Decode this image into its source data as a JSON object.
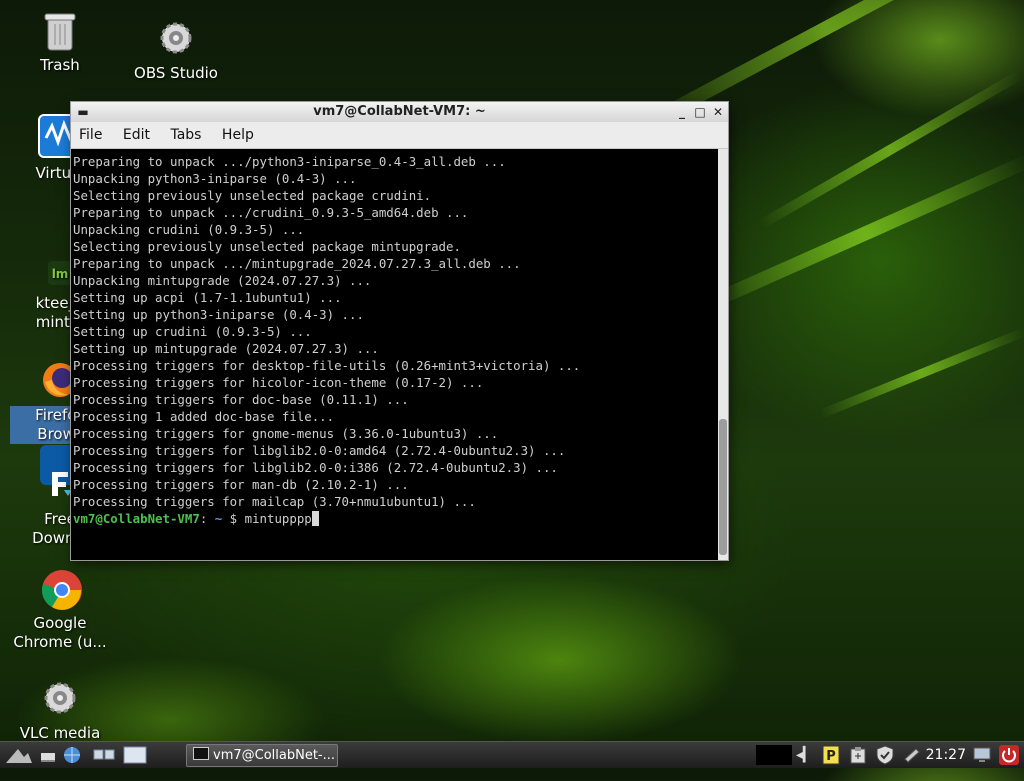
{
  "desktop": {
    "icons": [
      {
        "label": "Trash",
        "icon": "trash-icon"
      },
      {
        "label": "OBS Studio",
        "icon": "gear-icon"
      },
      {
        "label": "Virtual",
        "icon": "virtualbox-icon"
      },
      {
        "label": "ktee_li\nmint.p",
        "icon": "mint-file-icon"
      },
      {
        "label": "Firefox\nBrows",
        "icon": "firefox-icon"
      },
      {
        "label": "Free\nDownlo",
        "icon": "download-manager-icon"
      },
      {
        "label": "Google\nChrome (u...",
        "icon": "chrome-icon"
      },
      {
        "label": "VLC media\nplayer",
        "icon": "gear-icon"
      }
    ]
  },
  "window": {
    "title": "vm7@CollabNet-VM7: ~",
    "menu": [
      "File",
      "Edit",
      "Tabs",
      "Help"
    ],
    "lines": [
      "Preparing to unpack .../python3-iniparse_0.4-3_all.deb ...",
      "Unpacking python3-iniparse (0.4-3) ...",
      "Selecting previously unselected package crudini.",
      "Preparing to unpack .../crudini_0.9.3-5_amd64.deb ...",
      "Unpacking crudini (0.9.3-5) ...",
      "Selecting previously unselected package mintupgrade.",
      "Preparing to unpack .../mintupgrade_2024.07.27.3_all.deb ...",
      "Unpacking mintupgrade (2024.07.27.3) ...",
      "Setting up acpi (1.7-1.1ubuntu1) ...",
      "Setting up python3-iniparse (0.4-3) ...",
      "Setting up crudini (0.9.3-5) ...",
      "Setting up mintupgrade (2024.07.27.3) ...",
      "Processing triggers for desktop-file-utils (0.26+mint3+victoria) ...",
      "Processing triggers for hicolor-icon-theme (0.17-2) ...",
      "Processing triggers for doc-base (0.11.1) ...",
      "Processing 1 added doc-base file...",
      "Processing triggers for gnome-menus (3.36.0-1ubuntu3) ...",
      "Processing triggers for libglib2.0-0:amd64 (2.72.4-0ubuntu2.3) ...",
      "Processing triggers for libglib2.0-0:i386 (2.72.4-0ubuntu2.3) ...",
      "Processing triggers for man-db (2.10.2-1) ...",
      "Processing triggers for mailcap (3.70+nmu1ubuntu1) ..."
    ],
    "prompt_user": "vm7@CollabNet-VM7",
    "prompt_sep": ":",
    "prompt_path": " ~",
    "prompt_symbol": " $ ",
    "command": "mintupppp"
  },
  "taskbar": {
    "task_label": "vm7@CollabNet-...",
    "clock": "21:27"
  }
}
